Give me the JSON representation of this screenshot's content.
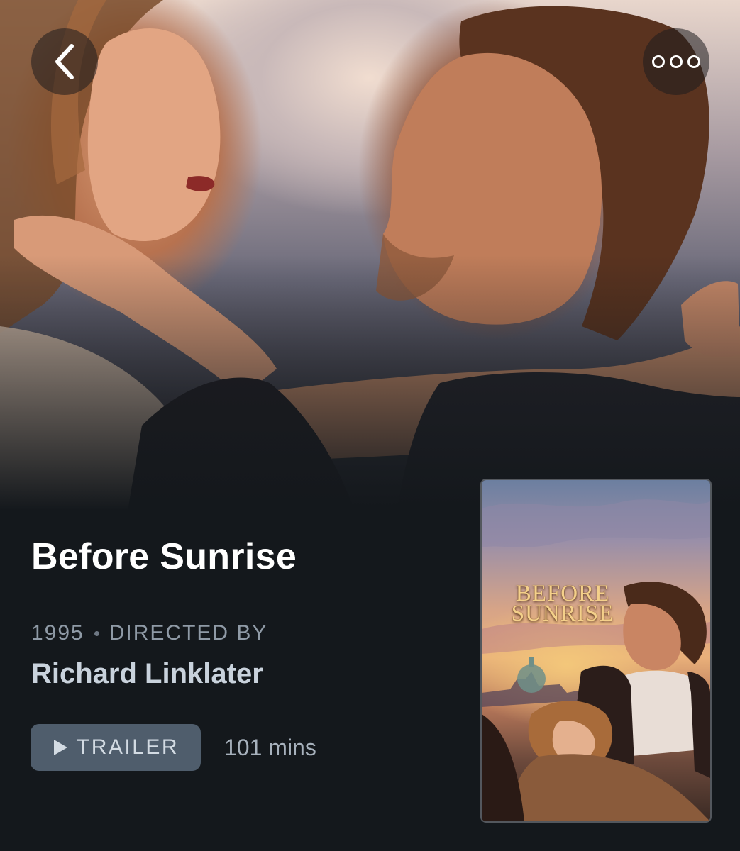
{
  "nav": {
    "back_icon": "chevron-left-icon",
    "more_icon": "more-dots-icon"
  },
  "film": {
    "title": "Before Sunrise",
    "year": "1995",
    "directed_by_label": "DIRECTED BY",
    "director": "Richard Linklater",
    "runtime": "101 mins"
  },
  "actions": {
    "trailer_label": "TRAILER",
    "trailer_icon": "play-icon"
  },
  "poster": {
    "title_line1": "BEFORE",
    "title_line2": "SUNRISE"
  },
  "colors": {
    "background": "#14181c",
    "title": "#ffffff",
    "meta": "#8f9aa6",
    "director": "#c9d2dc",
    "trailer_button": "#4f5d6c"
  }
}
